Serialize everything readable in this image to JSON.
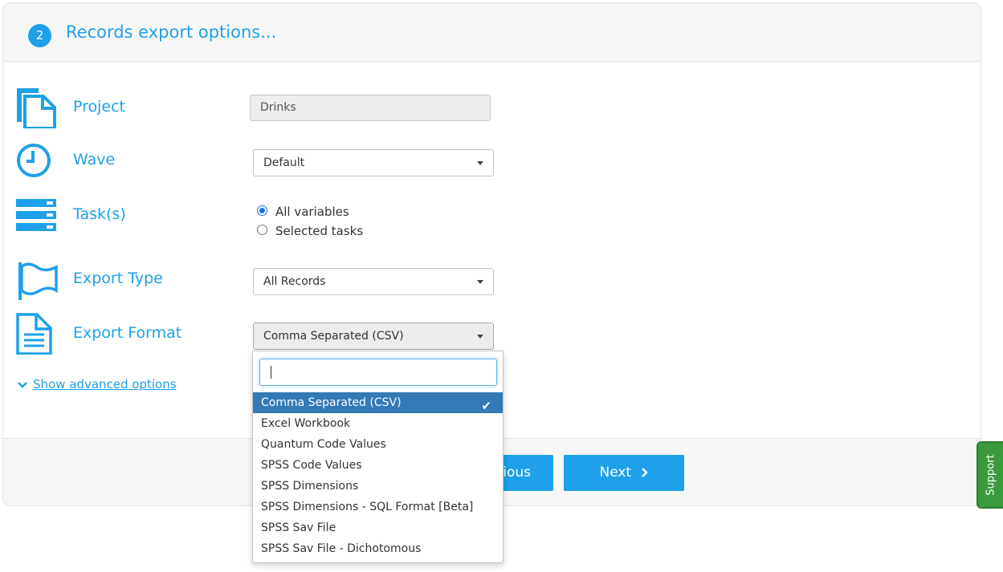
{
  "header": {
    "step_number": "2",
    "title": "Records export options..."
  },
  "rows": {
    "project": {
      "label": "Project",
      "value": "Drinks",
      "icon": "project-document-icon"
    },
    "wave": {
      "label": "Wave",
      "value": "Default",
      "icon": "clock-icon"
    },
    "tasks": {
      "label": "Task(s)",
      "icon": "server-list-icon",
      "options": [
        "All variables",
        "Selected tasks"
      ],
      "selected": "All variables"
    },
    "export_type": {
      "label": "Export Type",
      "value": "All Records",
      "icon": "flag-icon"
    },
    "export_format": {
      "label": "Export Format",
      "value": "Comma Separated (CSV)",
      "icon": "file-text-icon"
    }
  },
  "advanced": {
    "label": "Show advanced options"
  },
  "footer": {
    "previous_label": "ious",
    "next_label": "Next"
  },
  "support": {
    "label": "Support"
  },
  "dropdown": {
    "search_value": "",
    "options": [
      "Comma Separated (CSV)",
      "Excel Workbook",
      "Quantum Code Values",
      "SPSS Code Values",
      "SPSS Dimensions",
      "SPSS Dimensions - SQL Format [Beta]",
      "SPSS Sav File",
      "SPSS Sav File - Dichotomous"
    ],
    "selected_index": 0
  },
  "colors": {
    "accent": "#1ea0ea",
    "selected_option_bg": "#337ab7",
    "support_bg": "#3b9a3b"
  }
}
